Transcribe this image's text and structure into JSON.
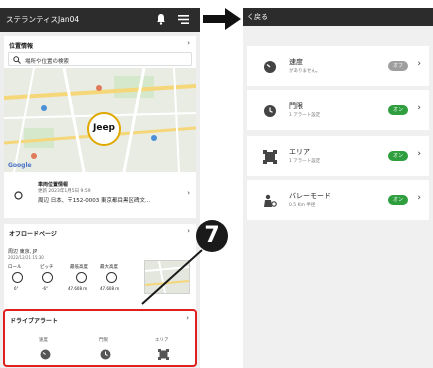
{
  "left_screen": {
    "header": {
      "title": "ステランティスJan04",
      "bell_icon": "bell-icon",
      "menu_icon": "menu-icon"
    },
    "location": {
      "title": "位置情報",
      "search_placeholder": "場所や位置の検索",
      "map_logo": "Jeep",
      "map_attribution": "Google",
      "vehicle": {
        "title": "車両位置情報",
        "updated": "更新 2023年1月5日 9:59",
        "address": "周辺 日本、〒152-0003 東京都目黒区碑文..."
      }
    },
    "offroad": {
      "title": "オフロードページ",
      "place": "周辺 東京, JP",
      "date": "2022/12/21 15:30",
      "gauges": [
        {
          "label": "ロール",
          "value": "6°"
        },
        {
          "label": "ピッチ",
          "value": "-6°"
        },
        {
          "label": "最低高度",
          "value": "47.608 m"
        },
        {
          "label": "最大高度",
          "value": "47.608 m"
        }
      ]
    },
    "drive_alert": {
      "title": "ドライブアラート",
      "items": [
        {
          "label": "速度",
          "icon": "speedometer-icon"
        },
        {
          "label": "門限",
          "icon": "clock-icon"
        },
        {
          "label": "エリア",
          "icon": "area-icon"
        }
      ]
    }
  },
  "callout_number": "7",
  "right_screen": {
    "back_label": "く戻る",
    "items": [
      {
        "name": "速度",
        "sub": "がありません。",
        "toggle": "オフ",
        "toggle_color": "#9e9e9e",
        "icon": "speedometer-icon"
      },
      {
        "name": "門限",
        "sub": "1 アラート設定",
        "toggle": "オン",
        "toggle_color": "#2e9e3e",
        "icon": "clock-icon"
      },
      {
        "name": "エリア",
        "sub": "1 アラート設定",
        "toggle": "オン",
        "toggle_color": "#2e9e3e",
        "icon": "area-icon"
      },
      {
        "name": "バレーモード",
        "sub": "0.5 Km 半径",
        "toggle": "オン",
        "toggle_color": "#2e9e3e",
        "icon": "valet-icon"
      }
    ]
  },
  "colors": {
    "header": "#2c2c2c",
    "highlight": "#e02020",
    "toggle_on": "#2e9e3e",
    "toggle_off": "#9e9e9e"
  }
}
